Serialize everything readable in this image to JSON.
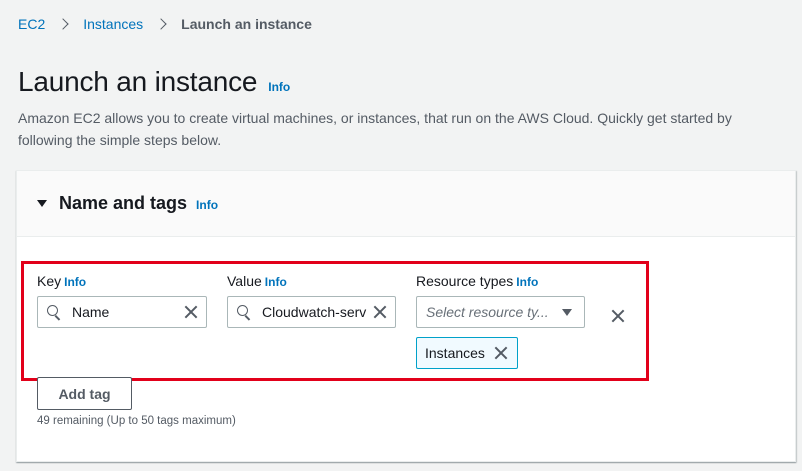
{
  "breadcrumb": {
    "items": [
      "EC2",
      "Instances"
    ],
    "current": "Launch an instance"
  },
  "page": {
    "title": "Launch an instance",
    "info_label": "Info",
    "description": "Amazon EC2 allows you to create virtual machines, or instances, that run on the AWS Cloud. Quickly get started by following the simple steps below."
  },
  "section": {
    "title": "Name and tags",
    "info_label": "Info"
  },
  "tag_row": {
    "key_label": "Key",
    "key_info": "Info",
    "key_value": "Name",
    "value_label": "Value",
    "value_info": "Info",
    "value_value": "Cloudwatch-serv",
    "resource_label": "Resource types",
    "resource_info": "Info",
    "resource_placeholder": "Select resource ty...",
    "resource_token": "Instances"
  },
  "actions": {
    "add_tag_label": "Add tag",
    "remaining_text": "49 remaining (Up to 50 tags maximum)"
  },
  "colors": {
    "link": "#0073bb",
    "highlight": "#e2001a",
    "token_border": "#00a1c9"
  },
  "icons": [
    "chevron-right-icon",
    "caret-down-icon",
    "search-icon",
    "clear-icon",
    "remove-icon"
  ]
}
